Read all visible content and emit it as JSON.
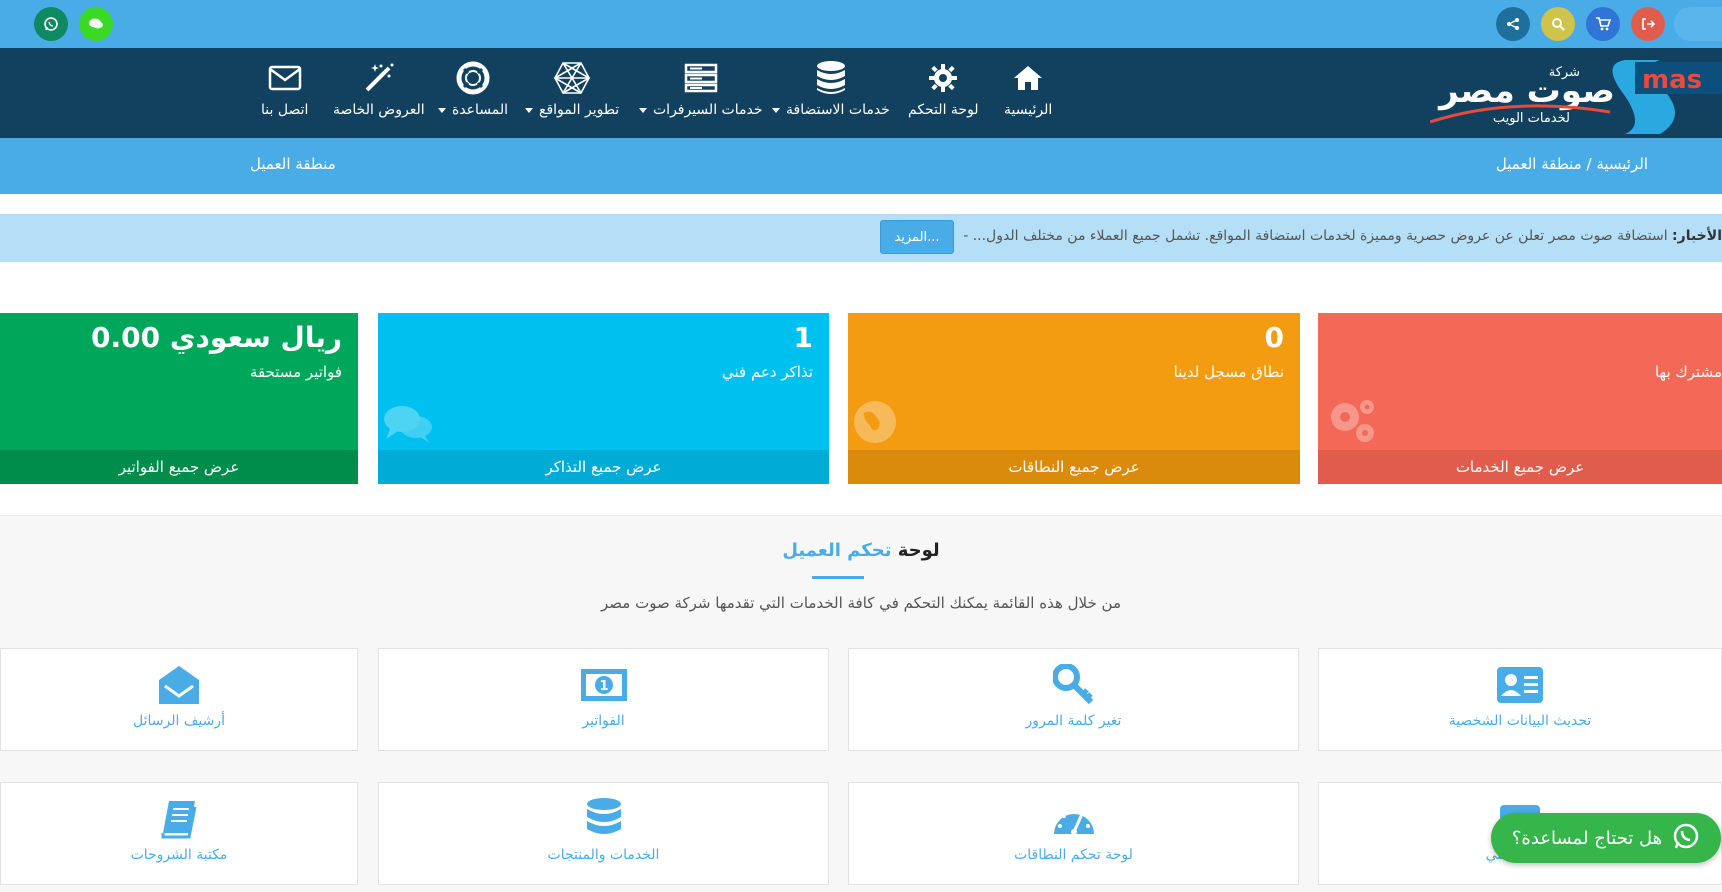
{
  "topbar": {
    "left_icons": [
      "whatsapp-icon",
      "chat-icon"
    ],
    "right_icons": [
      "share-icon",
      "search-icon",
      "cart-icon",
      "logout-icon"
    ]
  },
  "logo": {
    "latin_text": "mas",
    "arabic_main": "صوت مصر",
    "arabic_small": "شركة",
    "arabic_sub": "لخدمات الويب"
  },
  "nav": {
    "items": [
      {
        "label": "الرئيسية",
        "icon": "home-icon",
        "dropdown": false
      },
      {
        "label": "لوحة التحكم",
        "icon": "gear-icon",
        "dropdown": false
      },
      {
        "label": "خدمات الاستضافة",
        "icon": "database-icon",
        "dropdown": true
      },
      {
        "label": "خدمات السيرفرات",
        "icon": "server-icon",
        "dropdown": true
      },
      {
        "label": "تطوير المواقع",
        "icon": "network-icon",
        "dropdown": true
      },
      {
        "label": "المساعدة",
        "icon": "lifebuoy-icon",
        "dropdown": true
      },
      {
        "label": "العروض الخاصة",
        "icon": "magic-wand-icon",
        "dropdown": false
      },
      {
        "label": "اتصل بنا",
        "icon": "envelope-icon",
        "dropdown": false
      }
    ]
  },
  "breadcrumb": {
    "home": "الرئيسية",
    "separator": "/",
    "current": "منطقة العميل",
    "page_title": "منطقة العميل"
  },
  "news": {
    "label": "الأخبار:",
    "text": "استضافة صوت مصر تعلن عن عروض حصرية ومميزة لخدمات استضافة المواقع. تشمل جميع العملاء من مختلف الدول... -",
    "more_button": "المزيد..."
  },
  "cards": [
    {
      "number": "",
      "label": "مشترك بها",
      "footer": "عرض جميع الخدمات",
      "color": "#f46857",
      "footer_color": "#e05d4e"
    },
    {
      "number": "0",
      "label": "نطاق مسجل لدينا",
      "footer": "عرض جميع النطاقات",
      "color": "#f39c12",
      "footer_color": "#db8b0b"
    },
    {
      "number": "1",
      "label": "تذاكر دعم فني",
      "footer": "عرض جميع التذاكر",
      "color": "#00c0ef",
      "footer_color": "#00acd6"
    },
    {
      "number": "0.00 ريال سعودي",
      "label": "فواتير مستحقة",
      "footer": "عرض جميع الفواتير",
      "color": "#00a65a",
      "footer_color": "#008d4c"
    }
  ],
  "dashboard": {
    "title_dark": "لوحة",
    "title_blue": "تحكم العميل",
    "subtitle": "من خلال هذه القائمة يمكنك التحكم في كافة الخدمات التي تقدمها شركة صوت مصر",
    "tiles_row1": [
      {
        "label": "تحديث البيانات الشخصية",
        "icon": "id-card-icon"
      },
      {
        "label": "تغير كلمة المرور",
        "icon": "key-icon"
      },
      {
        "label": "الفواتير",
        "icon": "money-icon"
      },
      {
        "label": "أرشيف الرسائل",
        "icon": "open-envelope-icon"
      }
    ],
    "tiles_row2": [
      {
        "label": "الدعم الفني",
        "icon": "ticket-icon"
      },
      {
        "label": "لوحة تحكم النطاقات",
        "icon": "dashboard-icon"
      },
      {
        "label": "الخدمات والمنتجات",
        "icon": "database-icon"
      },
      {
        "label": "مكتبة الشروحات",
        "icon": "book-icon"
      }
    ]
  },
  "help": {
    "label": "هل تحتاج لمساعدة؟"
  },
  "colors": {
    "accent": "#4aace6",
    "nav_bg": "#12415f",
    "news_bg": "#b5dff6",
    "whatsapp": "#36b64a"
  }
}
